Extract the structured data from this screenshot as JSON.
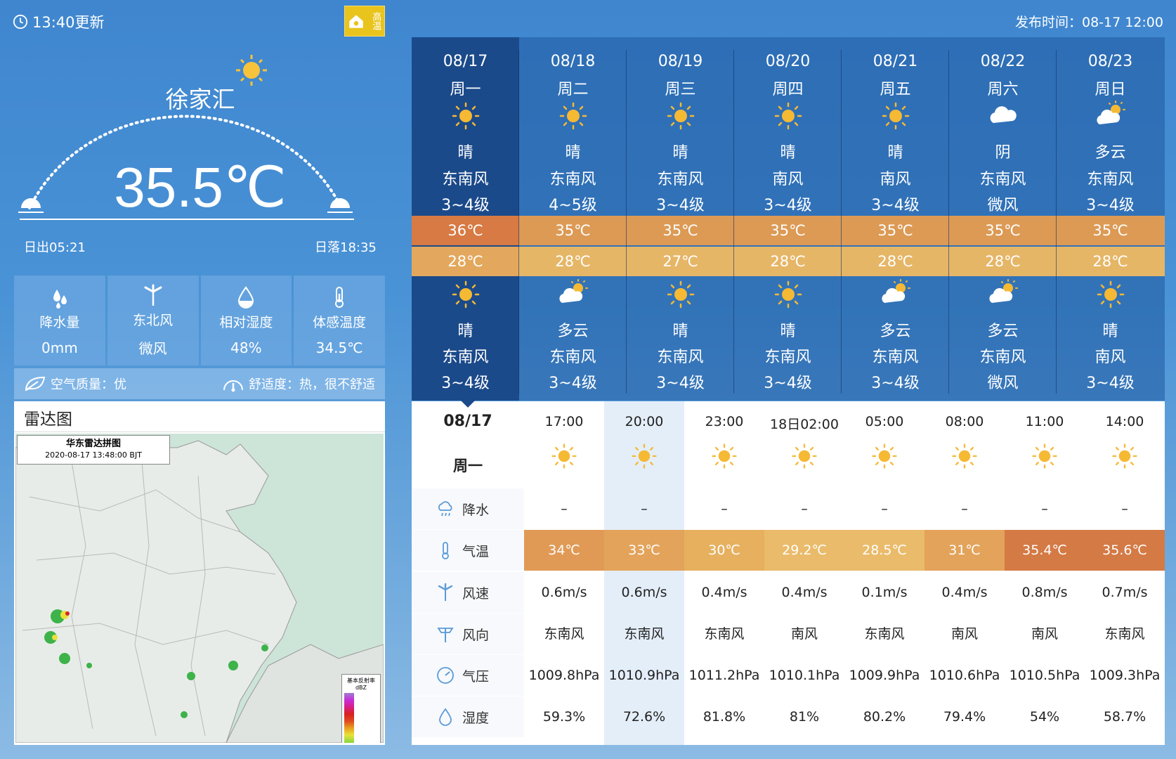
{
  "header": {
    "update_time": "13:40更新",
    "warning_badge": "高温",
    "publish_time": "发布时间：08-17 12:00"
  },
  "current": {
    "station": "徐家汇",
    "temperature": "35.5℃",
    "sunrise": "日出05:21",
    "sunset": "日落18:35",
    "metrics": [
      {
        "icon": "raindrops-icon",
        "label": "降水量",
        "value": "0mm"
      },
      {
        "icon": "wind-turbine-icon",
        "label": "东北风",
        "value": "微风"
      },
      {
        "icon": "humidity-drop-icon",
        "label": "相对湿度",
        "value": "48%"
      },
      {
        "icon": "thermometer-icon",
        "label": "体感温度",
        "value": "34.5℃"
      }
    ],
    "air_quality": "空气质量：优",
    "comfort": "舒适度：热，很不舒适"
  },
  "radar": {
    "title": "雷达图",
    "caption_line1": "华东雷达拼图",
    "caption_line2": "2020-08-17 13:48:00 BJT",
    "legend_title": "基本反射率",
    "legend_unit": "dBZ"
  },
  "daily": [
    {
      "date": "08/17",
      "week": "周一",
      "icon1": "sun",
      "weather1": "晴",
      "wind_dir1": "东南风",
      "wind_lvl1": "3~4级",
      "high": "36℃",
      "low": "28℃",
      "icon2": "sun",
      "weather2": "晴",
      "wind_dir2": "东南风",
      "wind_lvl2": "3~4级",
      "high_color": "#d77a44",
      "low_color": "#e3a85d"
    },
    {
      "date": "08/18",
      "week": "周二",
      "icon1": "sun",
      "weather1": "晴",
      "wind_dir1": "东南风",
      "wind_lvl1": "4~5级",
      "high": "35℃",
      "low": "28℃",
      "icon2": "cloud-sun",
      "weather2": "多云",
      "wind_dir2": "东南风",
      "wind_lvl2": "3~4级",
      "high_color": "#dc9a55",
      "low_color": "#e6b667"
    },
    {
      "date": "08/19",
      "week": "周三",
      "icon1": "sun",
      "weather1": "晴",
      "wind_dir1": "东南风",
      "wind_lvl1": "3~4级",
      "high": "35℃",
      "low": "27℃",
      "icon2": "sun",
      "weather2": "晴",
      "wind_dir2": "东南风",
      "wind_lvl2": "3~4级",
      "high_color": "#dc9a55",
      "low_color": "#e6b667"
    },
    {
      "date": "08/20",
      "week": "周四",
      "icon1": "sun",
      "weather1": "晴",
      "wind_dir1": "南风",
      "wind_lvl1": "3~4级",
      "high": "35℃",
      "low": "28℃",
      "icon2": "sun",
      "weather2": "晴",
      "wind_dir2": "东南风",
      "wind_lvl2": "3~4级",
      "high_color": "#dc9a55",
      "low_color": "#e6b667"
    },
    {
      "date": "08/21",
      "week": "周五",
      "icon1": "sun",
      "weather1": "晴",
      "wind_dir1": "南风",
      "wind_lvl1": "3~4级",
      "high": "35℃",
      "low": "28℃",
      "icon2": "cloud-sun",
      "weather2": "多云",
      "wind_dir2": "东南风",
      "wind_lvl2": "3~4级",
      "high_color": "#dc9a55",
      "low_color": "#e6b667"
    },
    {
      "date": "08/22",
      "week": "周六",
      "icon1": "cloud",
      "weather1": "阴",
      "wind_dir1": "东南风",
      "wind_lvl1": "微风",
      "high": "35℃",
      "low": "28℃",
      "icon2": "cloud-sun",
      "weather2": "多云",
      "wind_dir2": "东南风",
      "wind_lvl2": "微风",
      "high_color": "#dc9a55",
      "low_color": "#e6b667"
    },
    {
      "date": "08/23",
      "week": "周日",
      "icon1": "cloud-sun",
      "weather1": "多云",
      "wind_dir1": "东南风",
      "wind_lvl1": "3~4级",
      "high": "35℃",
      "low": "28℃",
      "icon2": "sun",
      "weather2": "晴",
      "wind_dir2": "南风",
      "wind_lvl2": "3~4级",
      "high_color": "#dc9a55",
      "low_color": "#e6b667"
    }
  ],
  "hourly": {
    "date": "08/17",
    "week": "周一",
    "row_labels": [
      "降水",
      "气温",
      "风速",
      "风向",
      "气压",
      "湿度"
    ],
    "hours": [
      {
        "time": "17:00",
        "rain": "–",
        "temp": "34℃",
        "temp_color": "#e09a55",
        "wind_speed": "0.6m/s",
        "wind_dir": "东南风",
        "pressure": "1009.8hPa",
        "humidity": "59.3%"
      },
      {
        "time": "20:00",
        "rain": "–",
        "temp": "33℃",
        "temp_color": "#e3a35a",
        "wind_speed": "0.6m/s",
        "wind_dir": "东南风",
        "pressure": "1010.9hPa",
        "humidity": "72.6%"
      },
      {
        "time": "23:00",
        "rain": "–",
        "temp": "30℃",
        "temp_color": "#e6b05f",
        "wind_speed": "0.4m/s",
        "wind_dir": "东南风",
        "pressure": "1011.2hPa",
        "humidity": "81.8%"
      },
      {
        "time": "18日02:00",
        "rain": "–",
        "temp": "29.2℃",
        "temp_color": "#eabb6a",
        "wind_speed": "0.4m/s",
        "wind_dir": "南风",
        "pressure": "1010.1hPa",
        "humidity": "81%"
      },
      {
        "time": "05:00",
        "rain": "–",
        "temp": "28.5℃",
        "temp_color": "#eabb6a",
        "wind_speed": "0.1m/s",
        "wind_dir": "东南风",
        "pressure": "1009.9hPa",
        "humidity": "80.2%"
      },
      {
        "time": "08:00",
        "rain": "–",
        "temp": "31℃",
        "temp_color": "#e3a35a",
        "wind_speed": "0.4m/s",
        "wind_dir": "南风",
        "pressure": "1010.6hPa",
        "humidity": "79.4%"
      },
      {
        "time": "11:00",
        "rain": "–",
        "temp": "35.4℃",
        "temp_color": "#d47a45",
        "wind_speed": "0.8m/s",
        "wind_dir": "南风",
        "pressure": "1010.5hPa",
        "humidity": "54%"
      },
      {
        "time": "14:00",
        "rain": "–",
        "temp": "35.6℃",
        "temp_color": "#d47a45",
        "wind_speed": "0.7m/s",
        "wind_dir": "东南风",
        "pressure": "1009.3hPa",
        "humidity": "58.7%"
      }
    ]
  },
  "colors": {
    "today_column": "#1b4a8a",
    "panel_blue": "#4a93d6",
    "warning_yellow": "#e9c41d"
  }
}
